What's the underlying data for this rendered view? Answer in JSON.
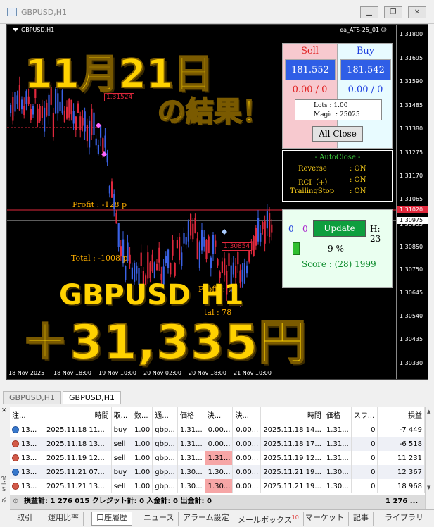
{
  "window": {
    "title": "GBPUSD,H1"
  },
  "chart": {
    "symbol_label": "GBPUSD,H1",
    "ea_label": "ea_ATS-25_01",
    "price_ticks": [
      "1.31800",
      "1.31695",
      "1.31590",
      "1.31485",
      "1.31380",
      "1.31275",
      "1.31170",
      "1.31065",
      "1.30955",
      "1.30850",
      "1.30750",
      "1.30645",
      "1.30540",
      "1.30435",
      "1.30330"
    ],
    "bid_tag": "1.31020",
    "ask_tag": "1.30975",
    "time_ticks": [
      "18 Nov 2025",
      "18 Nov 18:00",
      "19 Nov 10:00",
      "20 Nov 02:00",
      "20 Nov 18:00",
      "21 Nov 10:00"
    ],
    "annotations": {
      "level_label": "1.31524",
      "level_label2": "1.30854",
      "profit1": "Profit : -128 p",
      "total1": "Total : -1008 p",
      "profit2": "Profit : 70",
      "total2": "tal : 78"
    }
  },
  "overlay": {
    "date": "11月21日",
    "result": "の結果！",
    "pair": "GBPUSD H1",
    "amount": "＋31,335円"
  },
  "ea_panel": {
    "sell": {
      "title": "Sell",
      "price": "181.552",
      "ratio": "0.00 / 0"
    },
    "buy": {
      "title": "Buy",
      "price": "181.542",
      "ratio": "0.00 / 0"
    },
    "lots": "Lots    : 1.00",
    "magic": "Magic : 25025",
    "all_close": "All Close",
    "autoclose": {
      "title": "- AutoClose -",
      "rows": [
        {
          "name": "Reverse",
          "value": ": ON"
        },
        {
          "name": "RCI（+）",
          "value": ": ON"
        },
        {
          "name": "TrailingStop",
          "value": ": ON"
        }
      ]
    },
    "update": {
      "n1": "0",
      "n2": "0",
      "button": "Update",
      "h": "H: 23",
      "percent": "9 %",
      "score": "Score : (28) 1999"
    }
  },
  "chart_tabs": [
    "GBPUSD,H1",
    "GBPUSD,H1"
  ],
  "terminal": {
    "columns": [
      "注...",
      "時間",
      "取...",
      "数...",
      "通...",
      "価格",
      "決...",
      "決...",
      "時間",
      "価格",
      "スワ...",
      "損益"
    ],
    "rows": [
      {
        "id": "13...",
        "open": "2025.11.18 11...",
        "type": "buy",
        "vol": "1.00",
        "sym": "gbp...",
        "price": "1.31...",
        "sl": "0.00...",
        "tp": "0.00...",
        "close": "2025.11.18 14...",
        "cprice": "1.31...",
        "swap": "0",
        "profit": "-7 449"
      },
      {
        "id": "13...",
        "open": "2025.11.18 13...",
        "type": "sell",
        "vol": "1.00",
        "sym": "gbp...",
        "price": "1.31...",
        "sl": "0.00...",
        "tp": "0.00...",
        "close": "2025.11.18 17...",
        "cprice": "1.31...",
        "swap": "0",
        "profit": "-6 518"
      },
      {
        "id": "13...",
        "open": "2025.11.19 12...",
        "type": "sell",
        "vol": "1.00",
        "sym": "gbp...",
        "price": "1.31...",
        "sl": "1.31...",
        "tp": "0.00...",
        "close": "2025.11.19 12...",
        "cprice": "1.31...",
        "swap": "0",
        "profit": "11 231"
      },
      {
        "id": "13...",
        "open": "2025.11.21 07...",
        "type": "buy",
        "vol": "1.00",
        "sym": "gbp...",
        "price": "1.30...",
        "sl": "1.30...",
        "tp": "0.00...",
        "close": "2025.11.21 19...",
        "cprice": "1.30...",
        "swap": "0",
        "profit": "12 367"
      },
      {
        "id": "13...",
        "open": "2025.11.21 13...",
        "type": "sell",
        "vol": "1.00",
        "sym": "gbp...",
        "price": "1.30...",
        "sl": "1.30...",
        "tp": "0.00...",
        "close": "2025.11.21 19...",
        "cprice": "1.30...",
        "swap": "0",
        "profit": "18 968"
      }
    ],
    "summary": "損益計: 1 276 015  クレジット計: 0  入金計: 0  出金計: 0",
    "summary_end": "1 276 ...",
    "side_label": "ターミナル",
    "bottom_tabs": [
      "取引",
      "運用比率",
      "口座履歴",
      "ニュース",
      "アラーム設定",
      "メールボックス",
      "マーケット",
      "記事",
      "ライブラリ"
    ],
    "mail_badge": "10",
    "active_tab": "口座履歴"
  },
  "colors": {
    "chart_bg": "#000000",
    "bull": "#3a62e6",
    "bear": "#e0283c",
    "overlay": "#ffd200"
  }
}
